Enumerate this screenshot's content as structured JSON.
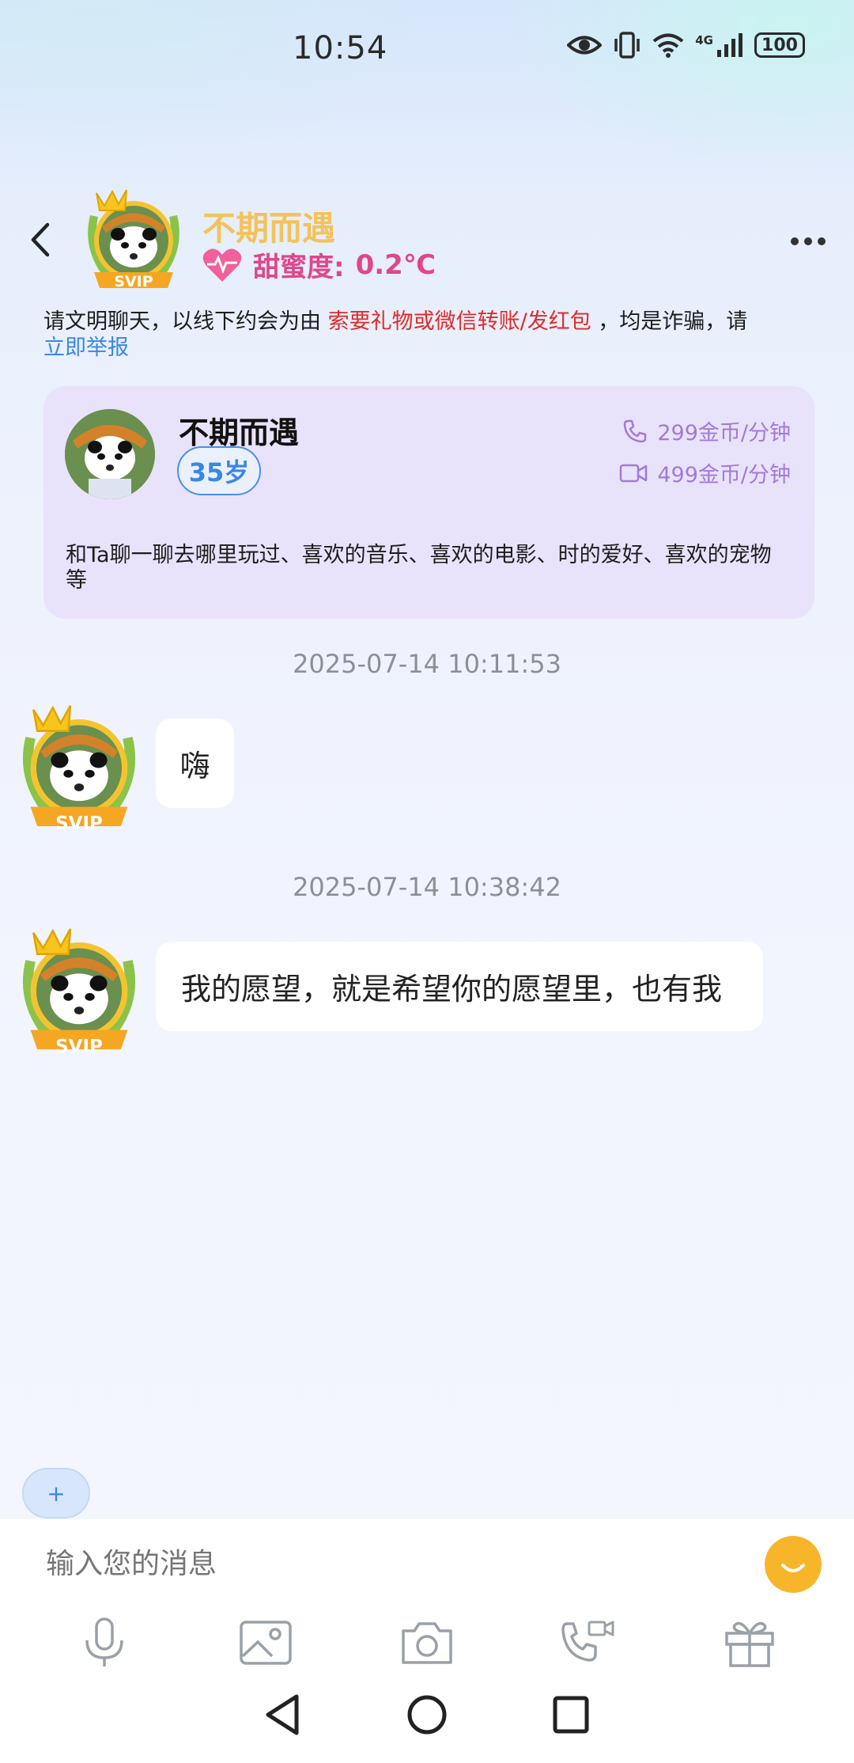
{
  "status_bar": {
    "time": "10:54",
    "network": "4G",
    "battery": "100"
  },
  "header": {
    "name": "不期而遇",
    "badge": "SVIP",
    "sweetness_label": "甜蜜度:",
    "sweetness_value": "0.2℃"
  },
  "notice": {
    "prefix": "请文明聊天，以线下约会为由 ",
    "highlight": "索要礼物或微信转账/发红包",
    "suffix": " ，均是诈骗，请",
    "link": "立即举报"
  },
  "profile_card": {
    "name": "不期而遇",
    "age": "35岁",
    "voice_price": "299金币/分钟",
    "video_price": "499金币/分钟",
    "description": "和Ta聊一聊去哪里玩过、喜欢的音乐、喜欢的电影、时的爱好、喜欢的宠物等"
  },
  "messages": [
    {
      "timestamp": "2025-07-14 10:11:53",
      "text": "嗨",
      "badge": "SVIP"
    },
    {
      "timestamp": "2025-07-14 10:38:42",
      "text": "我的愿望，就是希望你的愿望里，也有我",
      "badge": "SVIP"
    }
  ],
  "composer": {
    "plus_label": "+",
    "placeholder": "输入您的消息"
  },
  "colors": {
    "name_gold": "#f3c35a",
    "sweet_pink": "#e0468c",
    "warning_red": "#e02a2a",
    "link_blue": "#3a86e6",
    "price_purple": "#a27ad9",
    "card_bg": "#e9e2fb"
  },
  "icons": [
    "eye-icon",
    "vibrate-icon",
    "wifi-icon",
    "signal-icon",
    "back-arrow-icon",
    "heart-icon",
    "more-icon",
    "phone-icon",
    "video-icon",
    "mic-icon",
    "image-icon",
    "camera-icon",
    "video-call-icon",
    "gift-icon",
    "emoji-icon",
    "nav-back-icon",
    "nav-home-icon",
    "nav-recents-icon"
  ]
}
